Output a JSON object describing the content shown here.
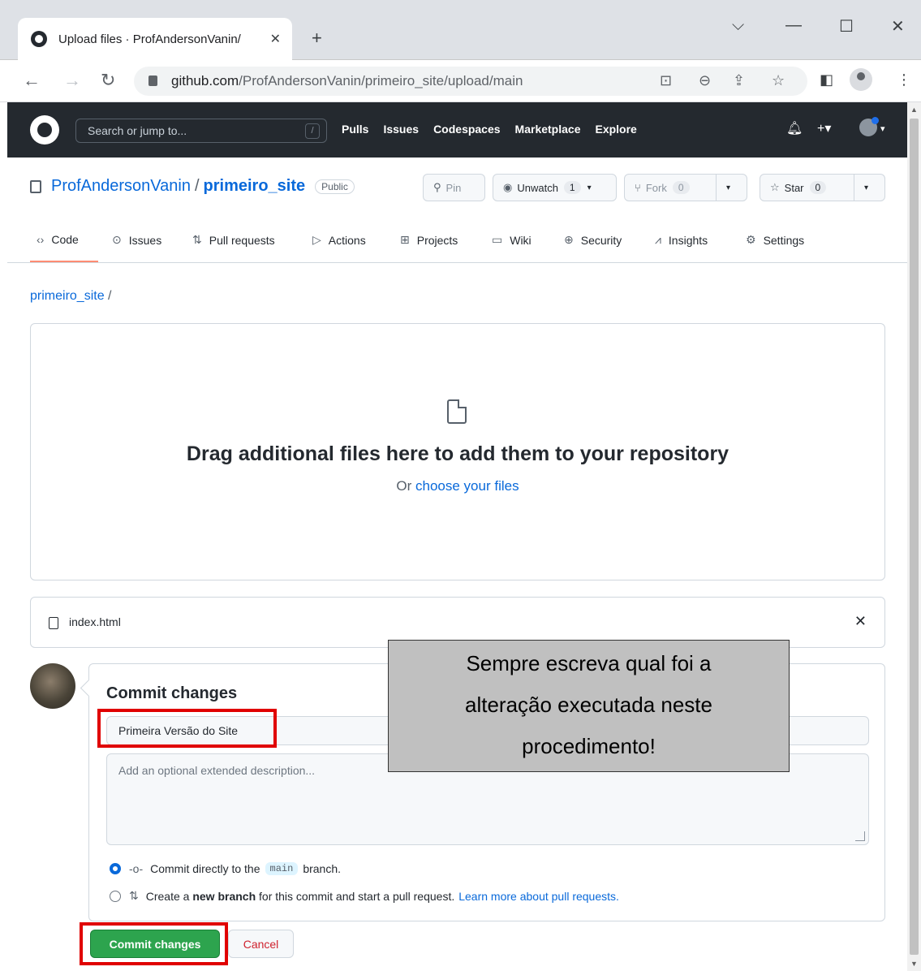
{
  "browser": {
    "tab_title": "Upload files · ProfAndersonVanin/",
    "url_host": "github.com",
    "url_path": "/ProfAndersonVanin/primeiro_site/upload/main"
  },
  "header": {
    "search_placeholder": "Search or jump to...",
    "slash_key": "/",
    "nav": [
      "Pulls",
      "Issues",
      "Codespaces",
      "Marketplace",
      "Explore"
    ]
  },
  "repo": {
    "owner": "ProfAndersonVanin",
    "separator": "/",
    "name": "primeiro_site",
    "visibility": "Public",
    "pin_label": "Pin",
    "unwatch_label": "Unwatch",
    "unwatch_count": "1",
    "fork_label": "Fork",
    "fork_count": "0",
    "star_label": "Star",
    "star_count": "0"
  },
  "repo_nav": [
    {
      "label": "Code",
      "icon": "code-icon",
      "active": true
    },
    {
      "label": "Issues",
      "icon": "issue-icon"
    },
    {
      "label": "Pull requests",
      "icon": "pull-request-icon"
    },
    {
      "label": "Actions",
      "icon": "play-icon"
    },
    {
      "label": "Projects",
      "icon": "table-icon"
    },
    {
      "label": "Wiki",
      "icon": "book-icon"
    },
    {
      "label": "Security",
      "icon": "shield-icon"
    },
    {
      "label": "Insights",
      "icon": "graph-icon"
    },
    {
      "label": "Settings",
      "icon": "gear-icon"
    }
  ],
  "upload": {
    "breadcrumb": "primeiro_site",
    "breadcrumb_sep": "/",
    "drop_title": "Drag additional files here to add them to your repository",
    "drop_or": "Or",
    "drop_link": "choose your files",
    "file_name": "index.html"
  },
  "commit": {
    "title": "Commit changes",
    "summary_value": "Primeira Versão do Site",
    "description_placeholder": "Add an optional extended description...",
    "option_direct_prefix": "Commit directly to the",
    "option_direct_branch": "main",
    "option_direct_suffix": "branch.",
    "option_new_prefix": "Create a",
    "option_new_bold": "new branch",
    "option_new_suffix": "for this commit and start a pull request.",
    "option_new_link": "Learn more about pull requests.",
    "commit_button": "Commit changes",
    "cancel_button": "Cancel"
  },
  "annotation": {
    "callout_lines": [
      "Sempre escreva qual foi a",
      "alteração executada neste",
      "procedimento!"
    ],
    "highlight_color": "#e00000"
  },
  "colors": {
    "accent_link": "#0969da",
    "commit_green": "#2da44e",
    "header_dark": "#24292f",
    "cancel_red": "#cf222e"
  }
}
